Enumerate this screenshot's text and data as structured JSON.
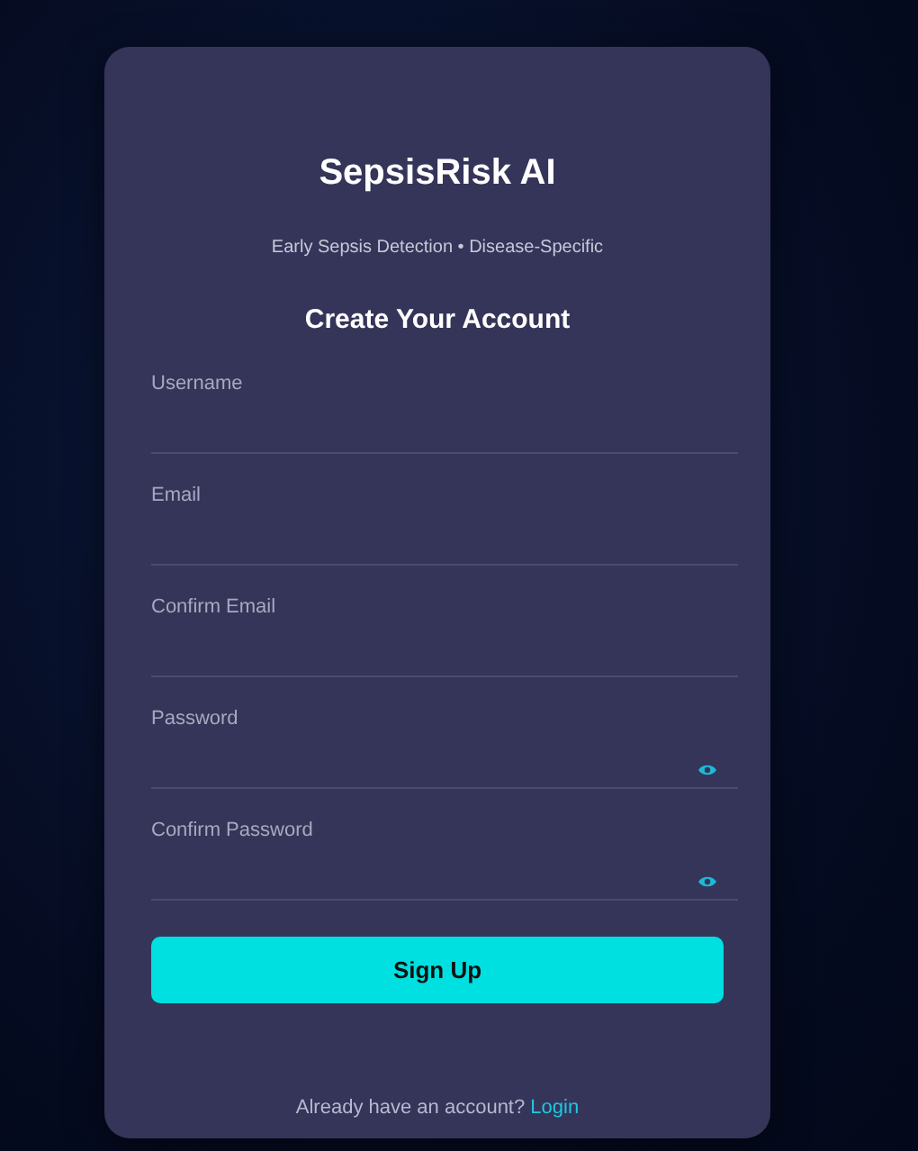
{
  "app": {
    "title": "SepsisRisk AI",
    "subtitle": "Early Sepsis Detection • Disease-Specific"
  },
  "form": {
    "heading": "Create Your Account",
    "fields": [
      {
        "kind": "text",
        "placeholder": "Username"
      },
      {
        "kind": "text",
        "placeholder": "Email"
      },
      {
        "kind": "text",
        "placeholder": "Confirm Email"
      },
      {
        "kind": "password",
        "placeholder": "Password"
      },
      {
        "kind": "password",
        "placeholder": "Confirm Password"
      }
    ],
    "submit": "Sign Up",
    "footer": {
      "text": "Already have an account?",
      "link": "Login"
    }
  }
}
